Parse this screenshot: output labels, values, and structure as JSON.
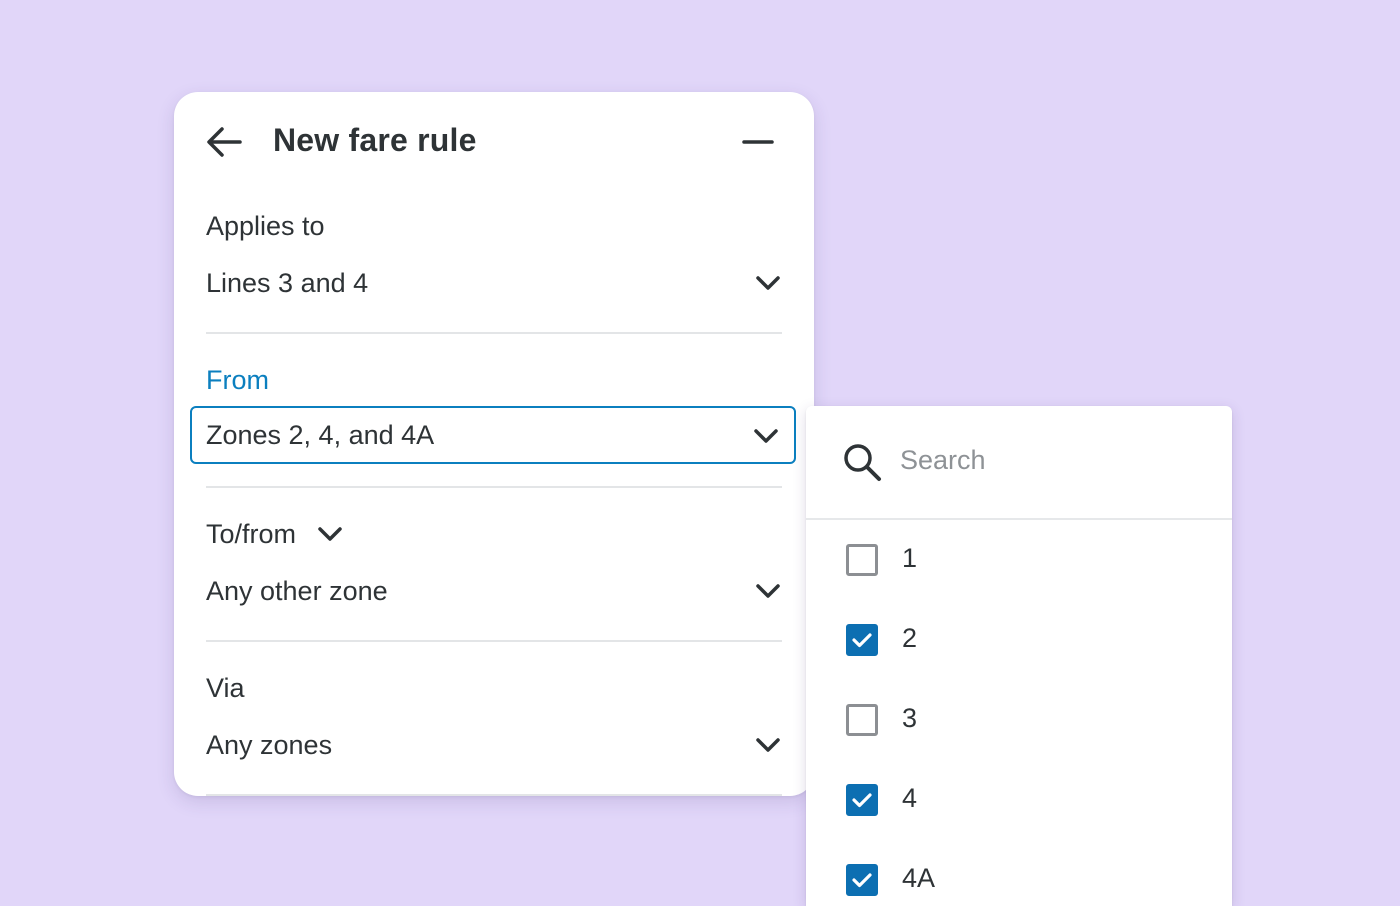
{
  "panel": {
    "title": "New fare rule",
    "fields": [
      {
        "label": "Applies to",
        "value": "Lines 3 and 4"
      },
      {
        "label": "From",
        "value": "Zones 2, 4, and 4A"
      },
      {
        "label": "To/from",
        "value": "Any other zone"
      },
      {
        "label": "Via",
        "value": "Any zones"
      }
    ]
  },
  "dropdown": {
    "search_placeholder": "Search",
    "options": [
      {
        "label": "1",
        "checked": false
      },
      {
        "label": "2",
        "checked": true
      },
      {
        "label": "3",
        "checked": false
      },
      {
        "label": "4",
        "checked": true
      },
      {
        "label": "4A",
        "checked": true
      }
    ]
  },
  "colors": {
    "background": "#e1d6f9",
    "accent": "#0b7fbf",
    "checkbox_checked": "#0c6fb2",
    "text": "#2e3336",
    "placeholder": "#8e9296"
  },
  "icons": {
    "back": "arrow-left-icon",
    "minimize": "minus-icon",
    "select": "chevron-down-icon",
    "search": "search-icon",
    "check": "check-icon"
  }
}
